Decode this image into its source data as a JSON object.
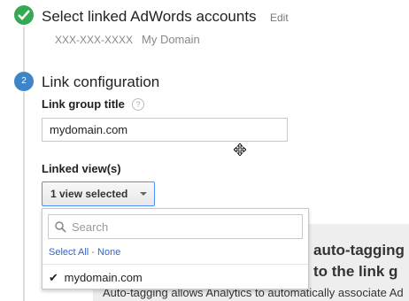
{
  "step1": {
    "title": "Select linked AdWords accounts",
    "edit_label": "Edit",
    "account_id": "XXX-XXX-XXXX",
    "account_name": "My Domain"
  },
  "step2": {
    "number": "2",
    "title": "Link configuration"
  },
  "link_group": {
    "label": "Link group title",
    "help_symbol": "?",
    "value": "mydomain.com"
  },
  "linked_views": {
    "label": "Linked view(s)",
    "selected_label": "1 view selected"
  },
  "dropdown": {
    "search_placeholder": "Search",
    "select_all": "Select All",
    "separator": " - ",
    "select_none": "None",
    "items": [
      {
        "label": "mydomain.com",
        "checked": true,
        "check_mark": "✔"
      }
    ]
  },
  "background": {
    "headline_line1": "auto-tagging",
    "headline_line2": "to the link g",
    "description": "Auto-tagging allows Analytics to automatically associate Ad"
  },
  "colors": {
    "step1_green": "#34a853",
    "step2_blue": "#3d85c6",
    "link_blue": "#3366cc",
    "select_border": "#4d90fe"
  },
  "icons": [
    "check-circle-icon",
    "help-icon",
    "move-cursor-icon",
    "caret-down-icon",
    "search-icon",
    "checkmark-icon"
  ]
}
